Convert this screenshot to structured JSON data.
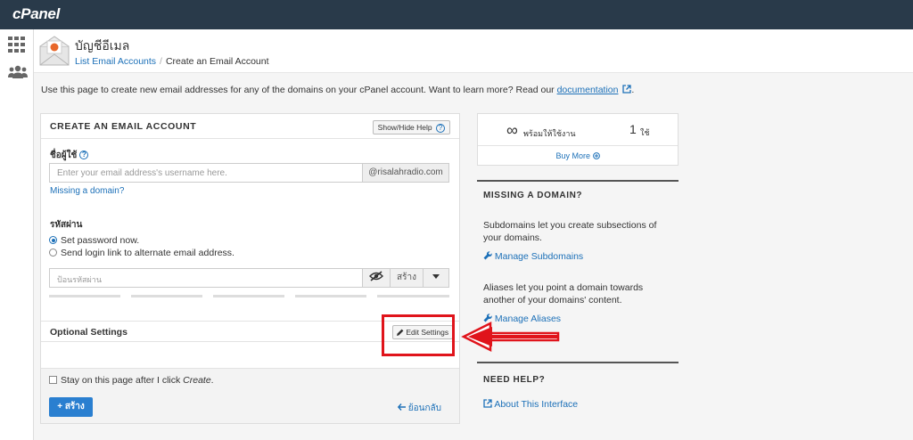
{
  "brand": "cPanel",
  "page": {
    "title": "บัญชีอีเมล",
    "breadcrumb": [
      "List Email Accounts",
      "Create an Email Account"
    ]
  },
  "intro": {
    "text": "Use this page to create new email addresses for any of the domains on your cPanel account. Want to learn more? Read our ",
    "link": "documentation",
    "tail": "."
  },
  "form": {
    "title": "CREATE AN EMAIL ACCOUNT",
    "help_button": "Show/Hide Help",
    "username": {
      "label": "ชื่อผู้ใช้",
      "placeholder": "Enter your email address's username here.",
      "domain": "@risalahradio.com",
      "missing_domain_link": "Missing a domain?"
    },
    "password": {
      "label": "รหัสผ่าน",
      "options": [
        {
          "label": "Set password now.",
          "selected": true
        },
        {
          "label": "Send login link to alternate email address.",
          "selected": false
        }
      ],
      "placeholder": "ป้อนรหัสผ่าน",
      "generate_button": "สร้าง",
      "strength_segments": 5
    },
    "optional_settings": {
      "title": "Optional Settings",
      "edit_button": "Edit Settings"
    },
    "stay_checkbox": {
      "prefix": "Stay on this page after I click ",
      "emphasis": "Create",
      "suffix": ".",
      "checked": false
    },
    "create_button": "+ สร้าง",
    "back_link": "ย้อนกลับ"
  },
  "stats": {
    "available_symbol": "∞",
    "available_label": "พร้อมให้ใช้งาน",
    "used_count": "1",
    "used_label": "ใช้",
    "buy_more": "Buy More"
  },
  "missing_domain": {
    "heading": "MISSING A DOMAIN?",
    "subdomains_text": "Subdomains let you create subsections of your domains.",
    "subdomains_link": "Manage Subdomains",
    "aliases_text": "Aliases let you point a domain towards another of your domains' content.",
    "aliases_link": "Manage Aliases"
  },
  "need_help": {
    "heading": "NEED HELP?",
    "link": "About This Interface"
  },
  "colors": {
    "topbar": "#293a4a",
    "link": "#1c70b8",
    "primary_button": "#2a7fd0",
    "annotation": "#e0141b"
  },
  "icons": [
    "grid-icon",
    "users-icon",
    "email-envelope-icon",
    "question-icon",
    "external-link-icon",
    "eye-slash-icon",
    "caret-down-icon",
    "plus-circle-icon",
    "wrench-icon",
    "pencil-icon",
    "arrow-left-icon"
  ]
}
